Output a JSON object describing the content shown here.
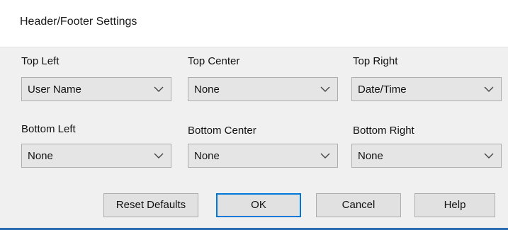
{
  "dialog": {
    "title": "Header/Footer Settings"
  },
  "fields": {
    "top_left": {
      "label": "Top Left",
      "value": "User Name"
    },
    "top_center": {
      "label": "Top Center",
      "value": "None"
    },
    "top_right": {
      "label": "Top Right",
      "value": "Date/Time"
    },
    "bottom_left": {
      "label": "Bottom Left",
      "value": "None"
    },
    "bottom_center": {
      "label": "Bottom Center",
      "value": "None"
    },
    "bottom_right": {
      "label": "Bottom Right",
      "value": "None"
    }
  },
  "buttons": {
    "reset_defaults": "Reset Defaults",
    "ok": "OK",
    "cancel": "Cancel",
    "help": "Help"
  },
  "icons": {
    "dropdown": "chevron-down-icon"
  },
  "colors": {
    "default_button_border": "#0078d7",
    "bottom_edge": "#2b6cb0"
  }
}
